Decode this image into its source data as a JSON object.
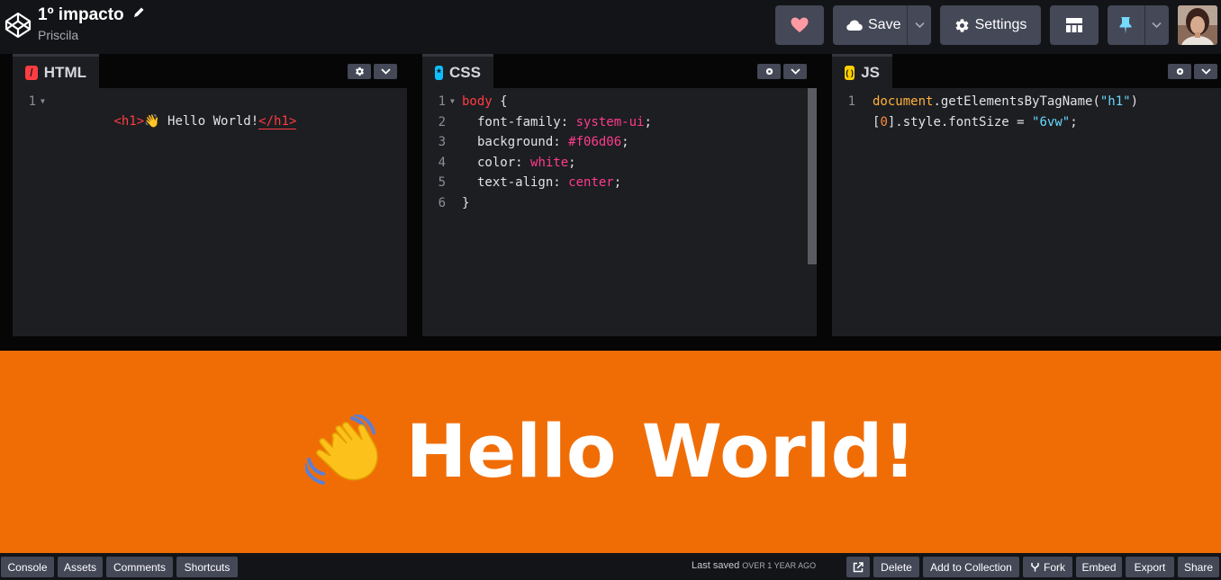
{
  "header": {
    "title": "1º impacto",
    "author": "Priscila",
    "save_label": "Save",
    "settings_label": "Settings"
  },
  "editors": [
    {
      "label": "HTML",
      "icon_glyph": "/",
      "icon_color": "#ff3c41"
    },
    {
      "label": "CSS",
      "icon_glyph": "*",
      "icon_color": "#0ebeff"
    },
    {
      "label": "JS",
      "icon_glyph": "( )",
      "icon_color": "#fcd000"
    }
  ],
  "html_code": {
    "line_numbers": [
      "1"
    ],
    "open_tag": "<h1>",
    "content": "👋 Hello World!",
    "close_tag": "</h1>"
  },
  "css_code": {
    "line_numbers": [
      "1",
      "2",
      "3",
      "4",
      "5",
      "6"
    ],
    "selector": "body",
    "open_brace": " {",
    "props": [
      {
        "name": "font-family",
        "value": "system-ui"
      },
      {
        "name": "background",
        "value": "#f06d06"
      },
      {
        "name": "color",
        "value": "white"
      },
      {
        "name": "text-align",
        "value": "center"
      }
    ],
    "close_brace": "}"
  },
  "js_code": {
    "line_numbers": [
      "1"
    ],
    "obj": "document",
    "method": ".getElementsByTagName(",
    "arg": "\"h1\"",
    "close": ")",
    "index_open": "[",
    "index": "0",
    "index_rest": "].style.fontSize = ",
    "value": "\"6vw\"",
    "semi": ";"
  },
  "preview": {
    "heading": "Hello World!",
    "emoji": "👋",
    "background": "#f06d06"
  },
  "footer": {
    "left_buttons": [
      "Console",
      "Assets",
      "Comments",
      "Shortcuts"
    ],
    "saved_prefix": "Last saved",
    "saved_when": "over 1 year ago",
    "right_buttons": [
      "Delete",
      "Add to Collection",
      "Fork",
      "Embed",
      "Export",
      "Share"
    ]
  },
  "colors": {
    "accent_heart": "#ff9aa2",
    "button_bg": "#444857",
    "editor_bg": "#1d1e22"
  }
}
